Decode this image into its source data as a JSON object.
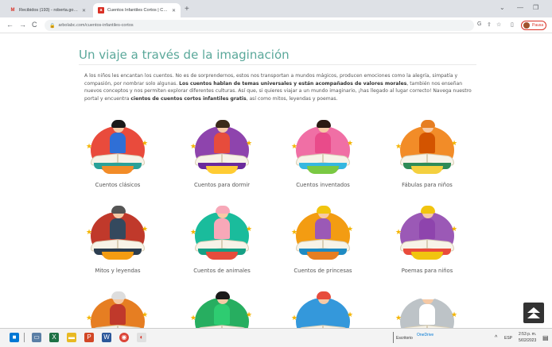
{
  "browser": {
    "tabs": [
      {
        "favicon": "gmail-icon",
        "title": "Recibidos (193) - roberta.gonzal...",
        "active": false
      },
      {
        "favicon": "arbolabc-icon",
        "title": "Cuentos Infantiles Cortos | Cuent...",
        "active": true
      }
    ],
    "new_tab": "+",
    "url": "arbolabc.com/cuentos-infantiles-cortos",
    "profile_label": "Pausa"
  },
  "page": {
    "title": "Un viaje a través de la imaginación",
    "intro_parts": [
      {
        "text": "A los niños les encantan los cuentos. No es de sorprendernos, estos nos transportan a mundos mágicos, producen emociones como la alegría, simpatía y compasión, por nombrar solo algunas. ",
        "bold": false
      },
      {
        "text": "Los cuentos hablan de temas universales y están acompañados de valores morales",
        "bold": true
      },
      {
        "text": ", también nos enseñan nuevos conceptos y nos permiten explorar diferentes culturas. Así que, si quieres viajar a un mundo imaginario, ¡has llegado al lugar correcto! Navega nuestro portal y encuentra ",
        "bold": false
      },
      {
        "text": "cientos de cuentos cortos infantiles gratis",
        "bold": true
      },
      {
        "text": ", así como mitos, leyendas y poemas.",
        "bold": false
      }
    ],
    "categories": [
      {
        "label": "Cuentos clásicos",
        "ring": "#e94b3c",
        "cover": "#2aa198",
        "base": "#f28c28",
        "hair": "#1a1a1a",
        "body": "#2f6fd6"
      },
      {
        "label": "Cuentos para dormir",
        "ring": "#8e44ad",
        "cover": "#6a2a9c",
        "base": "#ffcc33",
        "hair": "#3b2a1a",
        "body": "#e74c3c"
      },
      {
        "label": "Cuentos inventados",
        "ring": "#f06fa5",
        "cover": "#35b7e0",
        "base": "#7ac943",
        "hair": "#2b1a12",
        "body": "#e94b8a"
      },
      {
        "label": "Fábulas para niños",
        "ring": "#f28c28",
        "cover": "#2e8b57",
        "base": "#f4d03f",
        "hair": "#e67e22",
        "body": "#d35400"
      },
      {
        "label": "Mitos y leyendas",
        "ring": "#c0392b",
        "cover": "#2c3e50",
        "base": "#f39c12",
        "hair": "#555555",
        "body": "#34495e"
      },
      {
        "label": "Cuentos de animales",
        "ring": "#1abc9c",
        "cover": "#16a085",
        "base": "#e74c3c",
        "hair": "#f7a8b8",
        "body": "#f7a8b8"
      },
      {
        "label": "Cuentos de princesas",
        "ring": "#f39c12",
        "cover": "#1e8bc3",
        "base": "#e67e22",
        "hair": "#f1c40f",
        "body": "#9b59b6"
      },
      {
        "label": "Poemas para niños",
        "ring": "#9b59b6",
        "cover": "#e94b3c",
        "base": "#f1c40f",
        "hair": "#f1c40f",
        "body": "#8e44ad"
      },
      {
        "label": "",
        "ring": "#e67e22",
        "cover": "#27ae60",
        "base": "#e74c3c",
        "hair": "#dddddd",
        "body": "#c0392b"
      },
      {
        "label": "",
        "ring": "#27ae60",
        "cover": "#2980b9",
        "base": "#f39c12",
        "hair": "#1a1a1a",
        "body": "#2ecc71"
      },
      {
        "label": "",
        "ring": "#3498db",
        "cover": "#e74c3c",
        "base": "#f1c40f",
        "hair": "#e74c3c",
        "body": "#3498db"
      },
      {
        "label": "",
        "ring": "#bdc3c7",
        "cover": "#7f8c8d",
        "base": "#e74c3c",
        "hair": "#ffffff",
        "body": "#ffffff"
      }
    ]
  },
  "taskbar": {
    "search_text": "Escritorio",
    "onedrive": "OneDrive",
    "lang": "ESP",
    "time": "2:53 p. m.",
    "date": "5/02/2023"
  }
}
